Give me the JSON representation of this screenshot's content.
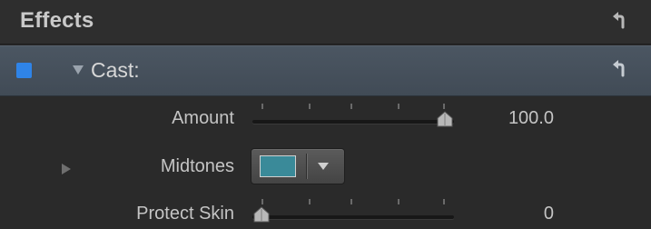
{
  "header": {
    "title": "Effects",
    "reset_icon": "reset-arrow-icon"
  },
  "effect": {
    "enabled": true,
    "checkbox_color": "#2f84e8",
    "label": "Cast:",
    "expanded": true,
    "reset_icon": "reset-arrow-icon"
  },
  "params": {
    "amount": {
      "label": "Amount",
      "value": "100.0",
      "fraction": 1.0
    },
    "midtones": {
      "label": "Midtones",
      "color": "#3a8a99",
      "expanded": false
    },
    "protect_skin": {
      "label": "Protect Skin",
      "value": "0",
      "fraction": 0.0
    }
  }
}
